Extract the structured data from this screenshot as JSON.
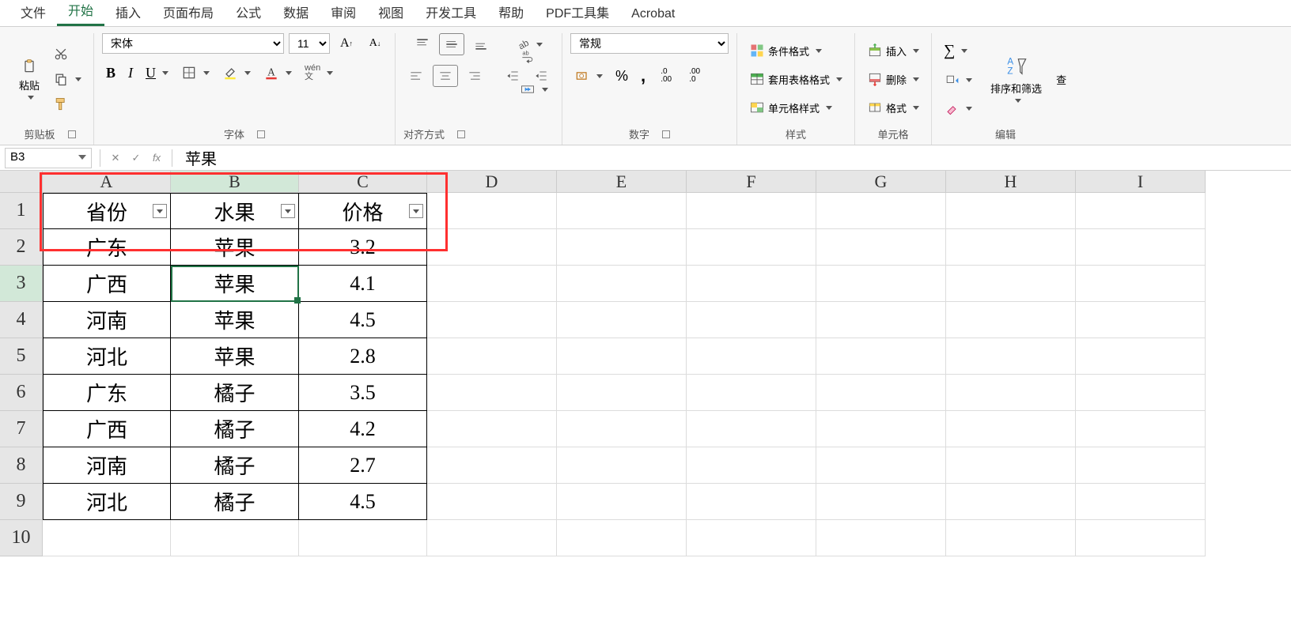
{
  "tabs": {
    "items": [
      "文件",
      "开始",
      "插入",
      "页面布局",
      "公式",
      "数据",
      "审阅",
      "视图",
      "开发工具",
      "帮助",
      "PDF工具集",
      "Acrobat"
    ],
    "active_index": 1
  },
  "ribbon": {
    "clipboard": {
      "paste": "粘贴",
      "label": "剪贴板"
    },
    "font": {
      "name": "宋体",
      "size": "11",
      "bold": "B",
      "italic": "I",
      "underline": "U",
      "phonetic": "wén",
      "label": "字体"
    },
    "alignment": {
      "label": "对齐方式"
    },
    "number": {
      "format": "常规",
      "label": "数字"
    },
    "styles": {
      "cond": "条件格式",
      "table": "套用表格格式",
      "cell": "单元格样式",
      "label": "样式"
    },
    "cells": {
      "insert": "插入",
      "delete": "删除",
      "format": "格式",
      "label": "单元格"
    },
    "editing": {
      "sort": "排序和筛选",
      "find": "查",
      "label": "编辑"
    }
  },
  "formula_bar": {
    "cell_ref": "B3",
    "fx": "fx",
    "value": "苹果"
  },
  "sheet": {
    "columns": [
      "A",
      "B",
      "C",
      "D",
      "E",
      "F",
      "G",
      "H",
      "I"
    ],
    "row_count": 10,
    "headers": [
      "省份",
      "水果",
      "价格"
    ],
    "rows": [
      [
        "广东",
        "苹果",
        "3.2"
      ],
      [
        "广西",
        "苹果",
        "4.1"
      ],
      [
        "河南",
        "苹果",
        "4.5"
      ],
      [
        "河北",
        "苹果",
        "2.8"
      ],
      [
        "广东",
        "橘子",
        "3.5"
      ],
      [
        "广西",
        "橘子",
        "4.2"
      ],
      [
        "河南",
        "橘子",
        "2.7"
      ],
      [
        "河北",
        "橘子",
        "4.5"
      ]
    ],
    "active_cell": "B3"
  }
}
